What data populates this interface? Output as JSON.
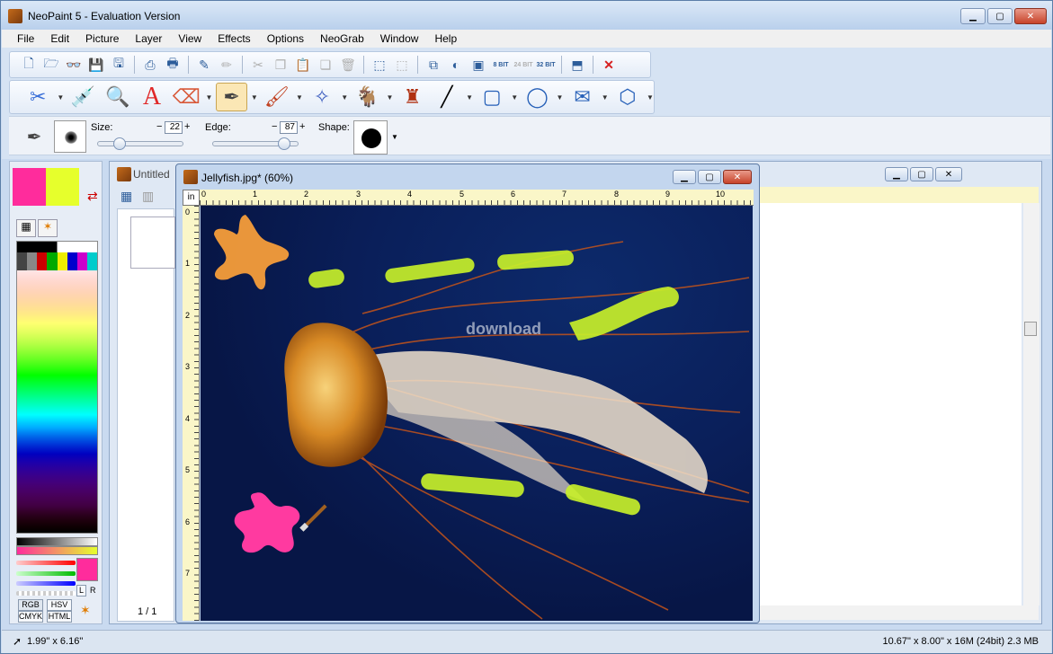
{
  "app": {
    "title": "NeoPaint 5 - Evaluation Version"
  },
  "menu": [
    "File",
    "Edit",
    "Picture",
    "Layer",
    "View",
    "Effects",
    "Options",
    "NeoGrab",
    "Window",
    "Help"
  ],
  "toolbar1": {
    "icons": [
      "new-icon",
      "open-icon",
      "browse-icon",
      "save-icon",
      "save-as-icon",
      "scan-icon",
      "print-icon",
      "edit-icon",
      "pencil-icon",
      "cut-icon",
      "copy-icon",
      "paste-icon",
      "paste-new-icon",
      "delete-icon",
      "select-icon",
      "deselect-icon",
      "resize-icon",
      "brightness-icon",
      "crop-icon",
      "8bit-icon",
      "24bit-icon",
      "32bit-icon",
      "screenshot-icon",
      "close-icon"
    ],
    "bit_labels": [
      "8 BIT",
      "24 BIT",
      "32 BIT"
    ]
  },
  "toolbar2": {
    "tools": [
      "scissors-tool",
      "eyedropper-tool",
      "zoom-tool",
      "text-tool",
      "eraser-tool",
      "pen-tool",
      "brush-tool",
      "airbrush-tool",
      "stamp-tool",
      "fill-tool",
      "line-tool",
      "rectangle-tool",
      "ellipse-tool",
      "polygon-tool",
      "3d-box-tool"
    ],
    "text_tool_glyph": "A"
  },
  "brush_options": {
    "size_label": "Size:",
    "size_value": "22",
    "edge_label": "Edge:",
    "edge_value": "87",
    "shape_label": "Shape:",
    "minus": "−",
    "plus": "+"
  },
  "colors": {
    "primary": "#ff2c9c",
    "secondary": "#e6ff2c"
  },
  "color_panel": {
    "buttons": [
      "RGB",
      "HSV",
      "CMYK",
      "HTML"
    ],
    "l_label": "L",
    "r_label": "R"
  },
  "untitled": {
    "title": "Untitled",
    "page_indicator": "1 / 1"
  },
  "jellyfish": {
    "title": "Jellyfish.jpg* (60%)",
    "unit": "in",
    "ruler_x": [
      "0",
      "1",
      "2",
      "3",
      "4",
      "5",
      "6",
      "7",
      "8",
      "9",
      "10"
    ],
    "ruler_y": [
      "0",
      "1",
      "2",
      "3",
      "4",
      "5",
      "6",
      "7"
    ],
    "watermark": "download"
  },
  "status": {
    "left": "1.99\" x 6.16\"",
    "right": "10.67\" x 8.00\" x 16M (24bit) 2.3 MB"
  }
}
